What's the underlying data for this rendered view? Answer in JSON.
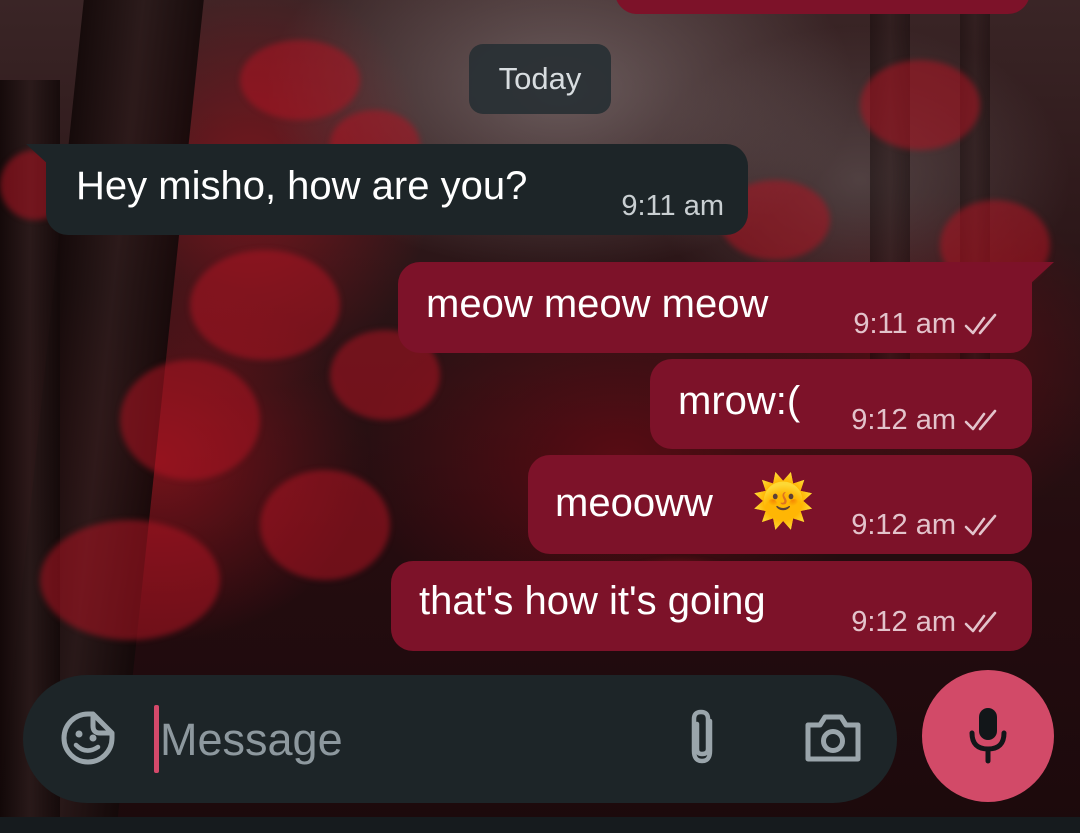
{
  "chat": {
    "day_separator": "Today",
    "messages": [
      {
        "direction": "incoming",
        "text": "Hey misho, how are you?",
        "time": "9:11 am"
      },
      {
        "direction": "outgoing",
        "text": "meow meow meow",
        "time": "9:11 am",
        "status": "read"
      },
      {
        "direction": "outgoing",
        "text": "mrow:(",
        "time": "9:12 am",
        "status": "read"
      },
      {
        "direction": "outgoing",
        "text": "meooww",
        "emoji": "🌞",
        "time": "9:12 am",
        "status": "read"
      },
      {
        "direction": "outgoing",
        "text": "that's how it's going",
        "time": "9:12 am",
        "status": "read"
      }
    ]
  },
  "composer": {
    "placeholder": "Message",
    "value": "",
    "icons": {
      "emoji": "sticker-emoji-icon",
      "attach": "paperclip-icon",
      "camera": "camera-icon",
      "mic": "microphone-icon"
    }
  },
  "colors": {
    "incoming_bubble": "#1d2528",
    "outgoing_bubble": "#7d1229",
    "accent": "#d24a68",
    "composer": "#1d2528"
  }
}
